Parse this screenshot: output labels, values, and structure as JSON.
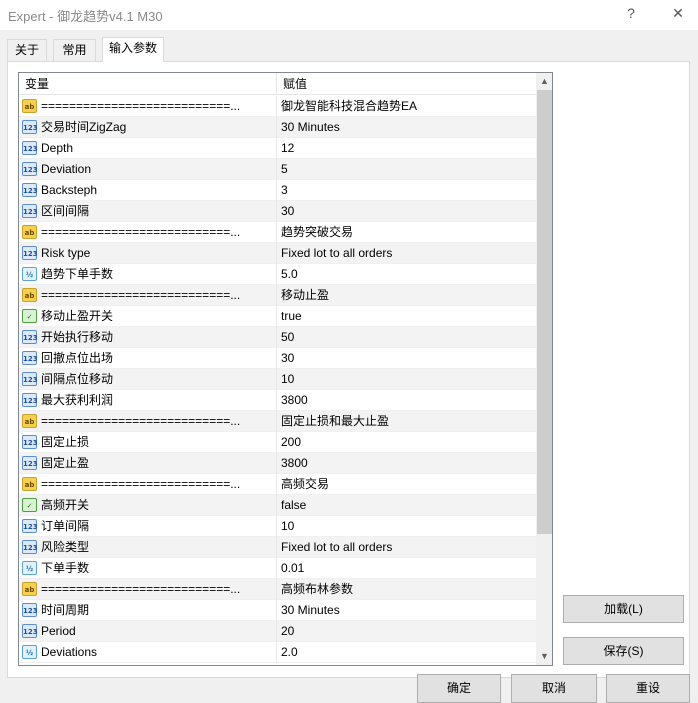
{
  "window": {
    "title": "Expert - 御龙趋势v4.1 M30",
    "help_glyph": "?",
    "close_glyph": "✕"
  },
  "tabs": [
    {
      "label": "关于"
    },
    {
      "label": "常用"
    },
    {
      "label": "输入参数"
    }
  ],
  "grid": {
    "headers": {
      "variable": "变量",
      "value": "赋值"
    },
    "rows": [
      {
        "icon": "ab",
        "name": "===========================...",
        "value": "御龙智能科技混合趋势EA"
      },
      {
        "icon": "123",
        "name": "交易时间ZigZag",
        "value": "30 Minutes"
      },
      {
        "icon": "123",
        "name": "Depth",
        "value": "12"
      },
      {
        "icon": "123",
        "name": "Deviation",
        "value": "5"
      },
      {
        "icon": "123",
        "name": "Backsteph",
        "value": "3"
      },
      {
        "icon": "123",
        "name": "区间间隔",
        "value": "30"
      },
      {
        "icon": "ab",
        "name": "===========================...",
        "value": "趋势突破交易"
      },
      {
        "icon": "123",
        "name": "Risk type",
        "value": "Fixed lot to all orders"
      },
      {
        "icon": "frac",
        "name": "趋势下单手数",
        "value": "5.0"
      },
      {
        "icon": "ab",
        "name": "===========================...",
        "value": "移动止盈"
      },
      {
        "icon": "bool",
        "name": "移动止盈开关",
        "value": "true"
      },
      {
        "icon": "123",
        "name": "开始执行移动",
        "value": "50"
      },
      {
        "icon": "123",
        "name": "回撤点位出场",
        "value": "30"
      },
      {
        "icon": "123",
        "name": "间隔点位移动",
        "value": "10"
      },
      {
        "icon": "123",
        "name": "最大获利利润",
        "value": "3800"
      },
      {
        "icon": "ab",
        "name": "===========================...",
        "value": "固定止损和最大止盈"
      },
      {
        "icon": "123",
        "name": "固定止损",
        "value": "200"
      },
      {
        "icon": "123",
        "name": "固定止盈",
        "value": "3800"
      },
      {
        "icon": "ab",
        "name": "===========================...",
        "value": "高频交易"
      },
      {
        "icon": "bool",
        "name": "高频开关",
        "value": "false"
      },
      {
        "icon": "123",
        "name": "订单间隔",
        "value": "10"
      },
      {
        "icon": "123",
        "name": "风险类型",
        "value": "Fixed lot to all orders"
      },
      {
        "icon": "frac",
        "name": "下单手数",
        "value": "0.01"
      },
      {
        "icon": "ab",
        "name": "===========================...",
        "value": "高频布林参数"
      },
      {
        "icon": "123",
        "name": "时间周期",
        "value": "30 Minutes"
      },
      {
        "icon": "123",
        "name": "Period",
        "value": "20"
      },
      {
        "icon": "frac",
        "name": "Deviations",
        "value": "2.0"
      }
    ]
  },
  "icons": {
    "ab": "ab",
    "123": "123",
    "bool": "✓",
    "frac": "½"
  },
  "buttons": {
    "load": "加载(L)",
    "save": "保存(S)",
    "ok": "确定",
    "cancel": "取消",
    "reset": "重设"
  }
}
